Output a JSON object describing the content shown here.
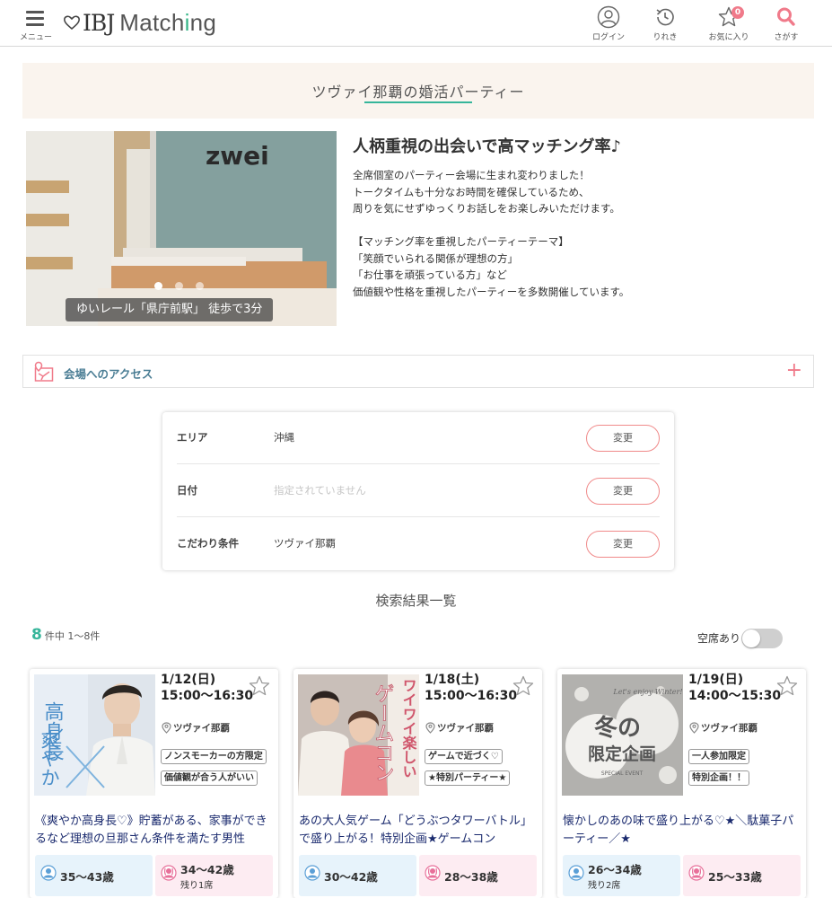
{
  "header": {
    "menu_label": "メニュー",
    "logo": {
      "ibj": "IBJ",
      "match_a": "Match",
      "match_i": "i",
      "match_b": "ng"
    },
    "nav": [
      {
        "label": "ログイン",
        "icon": "user-icon"
      },
      {
        "label": "りれき",
        "icon": "history-icon"
      },
      {
        "label": "お気に入り",
        "icon": "star-icon",
        "badge": "0"
      },
      {
        "label": "さがす",
        "icon": "search-icon"
      }
    ]
  },
  "page_title": "ツヴァイ那覇の婚活パーティー",
  "hero": {
    "sign_text": "zwei",
    "caption": "ゆいレール「県庁前駅」 徒歩で3分",
    "heading": "人柄重視の出会いで高マッチング率♪",
    "body": [
      "全席個室のパーティー会場に生まれ変わりました！",
      "トークタイムも十分なお時間を確保しているため、",
      "周りを気にせずゆっくりお話しをお楽しみいただけます。",
      "",
      "【マッチング率を重視したパーティーテーマ】",
      "「笑顔でいられる関係が理想の方」",
      "「お仕事を頑張っている方」など",
      "価値観や性格を重視したパーティーを多数開催しています。"
    ]
  },
  "access": {
    "label": "会場へのアクセス",
    "plus": "+"
  },
  "filter": {
    "area": {
      "label": "エリア",
      "value": "沖縄",
      "button": "変更"
    },
    "date": {
      "label": "日付",
      "placeholder": "指定されていません",
      "button": "変更"
    },
    "conditions": {
      "label": "こだわり条件",
      "value": "ツヴァイ那覇",
      "button": "変更"
    }
  },
  "results": {
    "heading": "検索結果一覧",
    "count": "8",
    "count_suffix": "件中 1〜8件",
    "vacancy_label": "空席あり"
  },
  "cards": [
    {
      "date": "1/12(日)",
      "time": "15:00〜16:30",
      "location": "ツヴァイ那覇",
      "tags": [
        "ノンスモーカーの方限定",
        "価値観が合う人がいい"
      ],
      "title": "《爽やか高身長♡》貯蓄がある、家事ができるなど理想の旦那さん条件を満たす男性",
      "img_text": [
        "高身長",
        "爽やか"
      ],
      "male_age": "35〜43歳",
      "male_sub": "",
      "female_age": "34〜42歳",
      "female_sub": "残り1席"
    },
    {
      "date": "1/18(土)",
      "time": "15:00〜16:30",
      "location": "ツヴァイ那覇",
      "tags": [
        "ゲームで近づく♡",
        "★特別パーティー★"
      ],
      "title": "あの大人気ゲーム「どうぶつタワーバトル」で盛り上がる！特別企画★ゲームコン",
      "img_text": [
        "ワイワイ楽しい",
        "ゲームコン"
      ],
      "male_age": "30〜42歳",
      "male_sub": "",
      "female_age": "28〜38歳",
      "female_sub": ""
    },
    {
      "date": "1/19(日)",
      "time": "14:00〜15:30",
      "location": "ツヴァイ那覇",
      "tags": [
        "一人参加限定",
        "特別企画！！"
      ],
      "title": "懐かしのあの味で盛り上がる♡★＼駄菓子パーティー／★",
      "img_text": [
        "冬の",
        "限定企画",
        "Let's enjoy Winter!",
        "SPECIAL EVENT"
      ],
      "male_age": "26〜34歳",
      "male_sub": "残り2席",
      "female_age": "25〜33歳",
      "female_sub": ""
    }
  ],
  "colors": {
    "accent": "#36b59a",
    "pink": "#f07a8a",
    "link": "#1a2a6e",
    "access": "#4a7d94"
  }
}
